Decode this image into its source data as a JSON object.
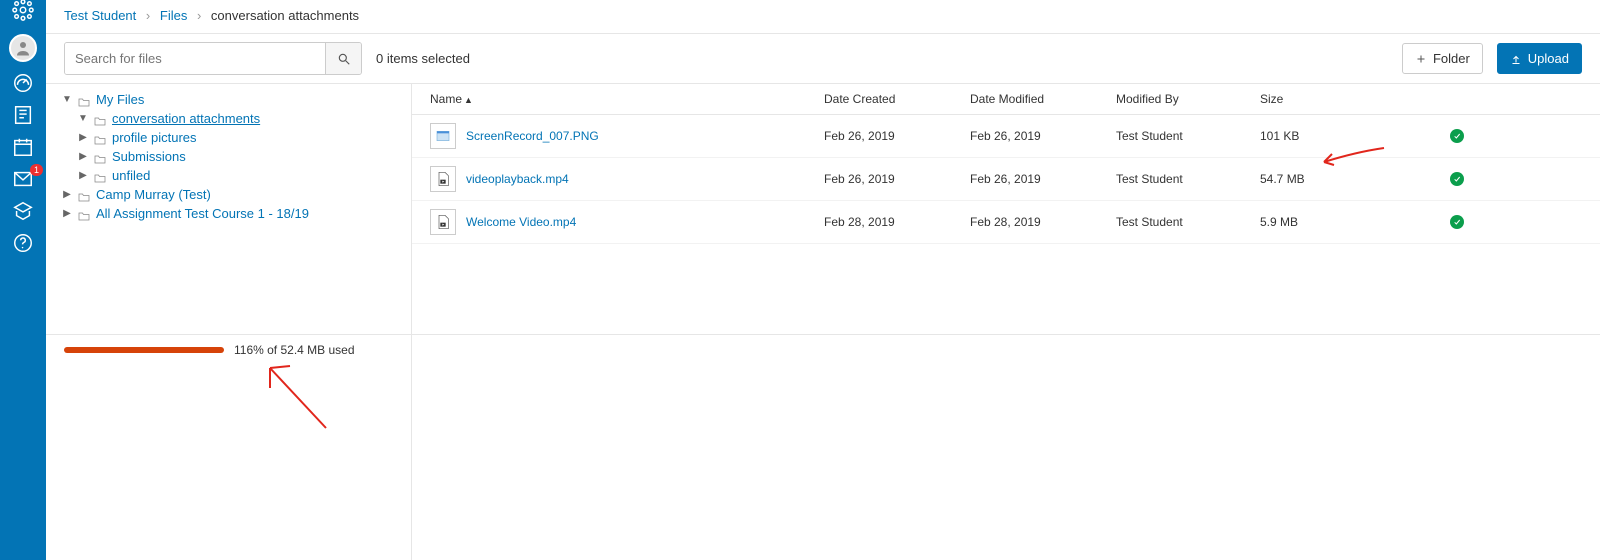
{
  "breadcrumb": {
    "root": "Test Student",
    "mid": "Files",
    "current": "conversation attachments"
  },
  "search": {
    "placeholder": "Search for files"
  },
  "selection": {
    "text": "0 items selected"
  },
  "buttons": {
    "folder": "Folder",
    "upload": "Upload"
  },
  "tree": {
    "myfiles": "My Files",
    "conv": "conversation attachments",
    "profile": "profile pictures",
    "subm": "Submissions",
    "unfiled": "unfiled",
    "camp": "Camp Murray (Test)",
    "course": "All Assignment Test Course 1 - 18/19"
  },
  "columns": {
    "name": "Name",
    "created": "Date Created",
    "modified": "Date Modified",
    "by": "Modified By",
    "size": "Size"
  },
  "files": [
    {
      "name": "ScreenRecord_007.PNG",
      "created": "Feb 26, 2019",
      "modified": "Feb 26, 2019",
      "by": "Test Student",
      "size": "101 KB",
      "kind": "image"
    },
    {
      "name": "videoplayback.mp4",
      "created": "Feb 26, 2019",
      "modified": "Feb 26, 2019",
      "by": "Test Student",
      "size": "54.7 MB",
      "kind": "video"
    },
    {
      "name": "Welcome Video.mp4",
      "created": "Feb 28, 2019",
      "modified": "Feb 28, 2019",
      "by": "Test Student",
      "size": "5.9 MB",
      "kind": "video"
    }
  ],
  "quota": {
    "percent": 116,
    "text": "116% of 52.4 MB used"
  },
  "nav": {
    "inbox_badge": "1"
  }
}
